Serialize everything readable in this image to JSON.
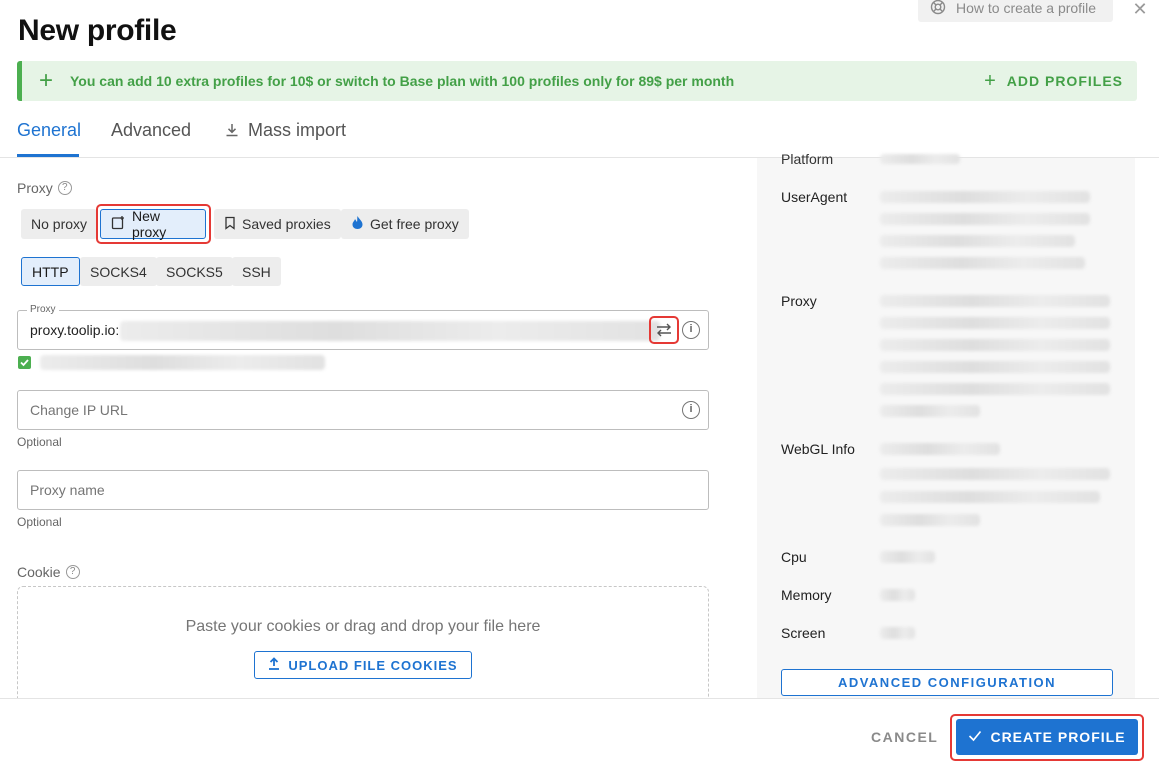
{
  "header": {
    "title": "New profile",
    "help_label": "How to create a profile",
    "close_icon": "close-icon"
  },
  "banner": {
    "message": "You can add 10 extra profiles for 10$ or switch to Base plan with 100 profiles only for 89$ per month",
    "action_label": "ADD PROFILES",
    "accent": "#43a047",
    "background": "#e6f4e6"
  },
  "tabs": [
    {
      "label": "General",
      "active": true
    },
    {
      "label": "Advanced",
      "active": false
    },
    {
      "label": "Mass import",
      "active": false,
      "icon": "download-icon"
    }
  ],
  "proxy": {
    "section_label": "Proxy",
    "source_options": [
      "No proxy",
      "New proxy",
      "Saved proxies",
      "Get free proxy"
    ],
    "selected_source": "New proxy",
    "types": [
      "HTTP",
      "SOCKS4",
      "SOCKS5",
      "SSH"
    ],
    "selected_type": "HTTP",
    "field_label": "Proxy",
    "field_value": "proxy.toolip.io:",
    "checked": true
  },
  "change_ip": {
    "placeholder": "Change IP URL",
    "hint": "Optional"
  },
  "proxy_name": {
    "placeholder": "Proxy name",
    "hint": "Optional"
  },
  "cookie": {
    "section_label": "Cookie",
    "drop_text": "Paste your cookies or drag and drop your file here",
    "upload_label": "UPLOAD FILE COOKIES"
  },
  "summary": {
    "keys": {
      "platform": "Platform",
      "useragent": "UserAgent",
      "proxy": "Proxy",
      "webgl": "WebGL Info",
      "cpu": "Cpu",
      "memory": "Memory",
      "screen": "Screen"
    },
    "advanced_label": "ADVANCED CONFIGURATION"
  },
  "footer": {
    "cancel_label": "CANCEL",
    "create_label": "CREATE PROFILE",
    "primary_color": "#1e73d1"
  }
}
